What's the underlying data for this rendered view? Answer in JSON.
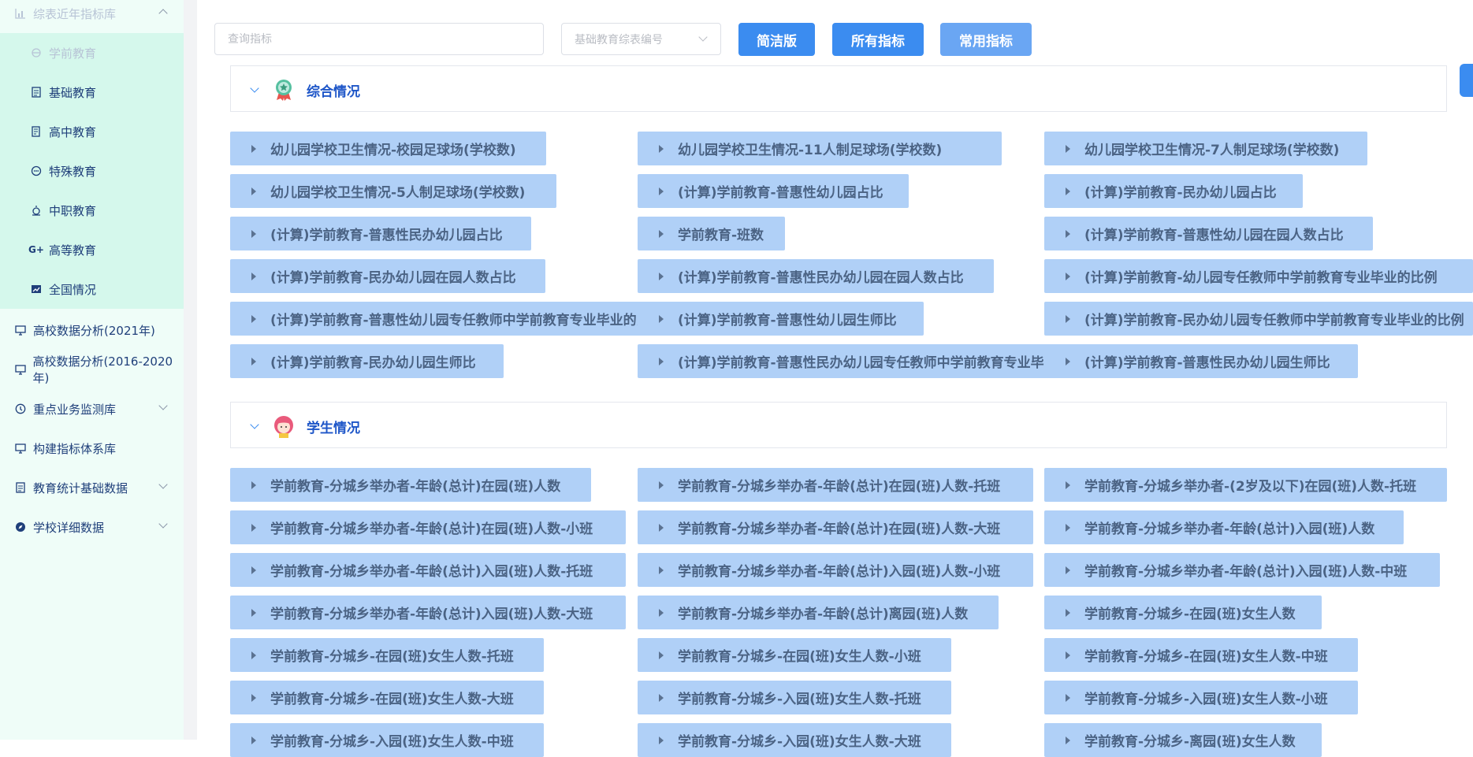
{
  "sidebar": {
    "items": [
      {
        "label": "综表近年指标库",
        "icon": "bar-chart-icon",
        "level": "top",
        "state": "expanded-faded"
      },
      {
        "label": "学前教育",
        "icon": "preschool-icon",
        "level": "sub",
        "state": "faded"
      },
      {
        "label": "基础教育",
        "icon": "document-icon",
        "level": "sub"
      },
      {
        "label": "高中教育",
        "icon": "list-document-icon",
        "level": "sub"
      },
      {
        "label": "特殊教育",
        "icon": "chat-bubble-icon",
        "level": "sub"
      },
      {
        "label": "中职教育",
        "icon": "alarm-icon",
        "level": "sub"
      },
      {
        "label": "高等教育",
        "icon": "google-plus-icon",
        "level": "sub"
      },
      {
        "label": "全国情况",
        "icon": "trend-chart-icon",
        "level": "sub"
      },
      {
        "label": "高校数据分析(2021年)",
        "icon": "monitor-icon",
        "level": "top"
      },
      {
        "label": "高校数据分析(2016-2020年)",
        "icon": "monitor-icon",
        "level": "top"
      },
      {
        "label": "重点业务监测库",
        "icon": "clock-icon",
        "level": "top",
        "expandable": true
      },
      {
        "label": "构建指标体系库",
        "icon": "monitor-icon",
        "level": "top"
      },
      {
        "label": "教育统计基础数据",
        "icon": "document-icon",
        "level": "top",
        "expandable": true
      },
      {
        "label": "学校详细数据",
        "icon": "compass-icon",
        "level": "top",
        "expandable": true
      }
    ]
  },
  "toolbar": {
    "search_placeholder": "查询指标",
    "select_placeholder": "基础教育综表编号",
    "btn_simple": "简洁版",
    "btn_all": "所有指标",
    "btn_common": "常用指标"
  },
  "sections": [
    {
      "title": "综合情况",
      "icon": "badge-icon",
      "rows": [
        [
          "幼儿园学校卫生情况-校园足球场(学校数)",
          "幼儿园学校卫生情况-11人制足球场(学校数)",
          "幼儿园学校卫生情况-7人制足球场(学校数)"
        ],
        [
          "幼儿园学校卫生情况-5人制足球场(学校数)",
          "(计算)学前教育-普惠性幼儿园占比",
          "(计算)学前教育-民办幼儿园占比"
        ],
        [
          "(计算)学前教育-普惠性民办幼儿园占比",
          "学前教育-班数",
          "(计算)学前教育-普惠性幼儿园在园人数占比"
        ],
        [
          "(计算)学前教育-民办幼儿园在园人数占比",
          "(计算)学前教育-普惠性民办幼儿园在园人数占比",
          "(计算)学前教育-幼儿园专任教师中学前教育专业毕业的比例"
        ],
        [
          "(计算)学前教育-普惠性幼儿园专任教师中学前教育专业毕业的比例",
          "(计算)学前教育-普惠性幼儿园生师比",
          "(计算)学前教育-民办幼儿园专任教师中学前教育专业毕业的比例"
        ],
        [
          "(计算)学前教育-民办幼儿园生师比",
          "(计算)学前教育-普惠性民办幼儿园专任教师中学前教育专业毕业的比例",
          "(计算)学前教育-普惠性民办幼儿园生师比"
        ]
      ]
    },
    {
      "title": "学生情况",
      "icon": "student-avatar-icon",
      "rows": [
        [
          "学前教育-分城乡举办者-年龄(总计)在园(班)人数",
          "学前教育-分城乡举办者-年龄(总计)在园(班)人数-托班",
          "学前教育-分城乡举办者-(2岁及以下)在园(班)人数-托班"
        ],
        [
          "学前教育-分城乡举办者-年龄(总计)在园(班)人数-小班",
          "学前教育-分城乡举办者-年龄(总计)在园(班)人数-大班",
          "学前教育-分城乡举办者-年龄(总计)入园(班)人数"
        ],
        [
          "学前教育-分城乡举办者-年龄(总计)入园(班)人数-托班",
          "学前教育-分城乡举办者-年龄(总计)入园(班)人数-小班",
          "学前教育-分城乡举办者-年龄(总计)入园(班)人数-中班"
        ],
        [
          "学前教育-分城乡举办者-年龄(总计)入园(班)人数-大班",
          "学前教育-分城乡举办者-年龄(总计)离园(班)人数",
          "学前教育-分城乡-在园(班)女生人数"
        ],
        [
          "学前教育-分城乡-在园(班)女生人数-托班",
          "学前教育-分城乡-在园(班)女生人数-小班",
          "学前教育-分城乡-在园(班)女生人数-中班"
        ],
        [
          "学前教育-分城乡-在园(班)女生人数-大班",
          "学前教育-分城乡-入园(班)女生人数-托班",
          "学前教育-分城乡-入园(班)女生人数-小班"
        ],
        [
          "学前教育-分城乡-入园(班)女生人数-中班",
          "学前教育-分城乡-入园(班)女生人数-大班",
          "学前教育-分城乡-离园(班)女生人数"
        ]
      ]
    }
  ]
}
